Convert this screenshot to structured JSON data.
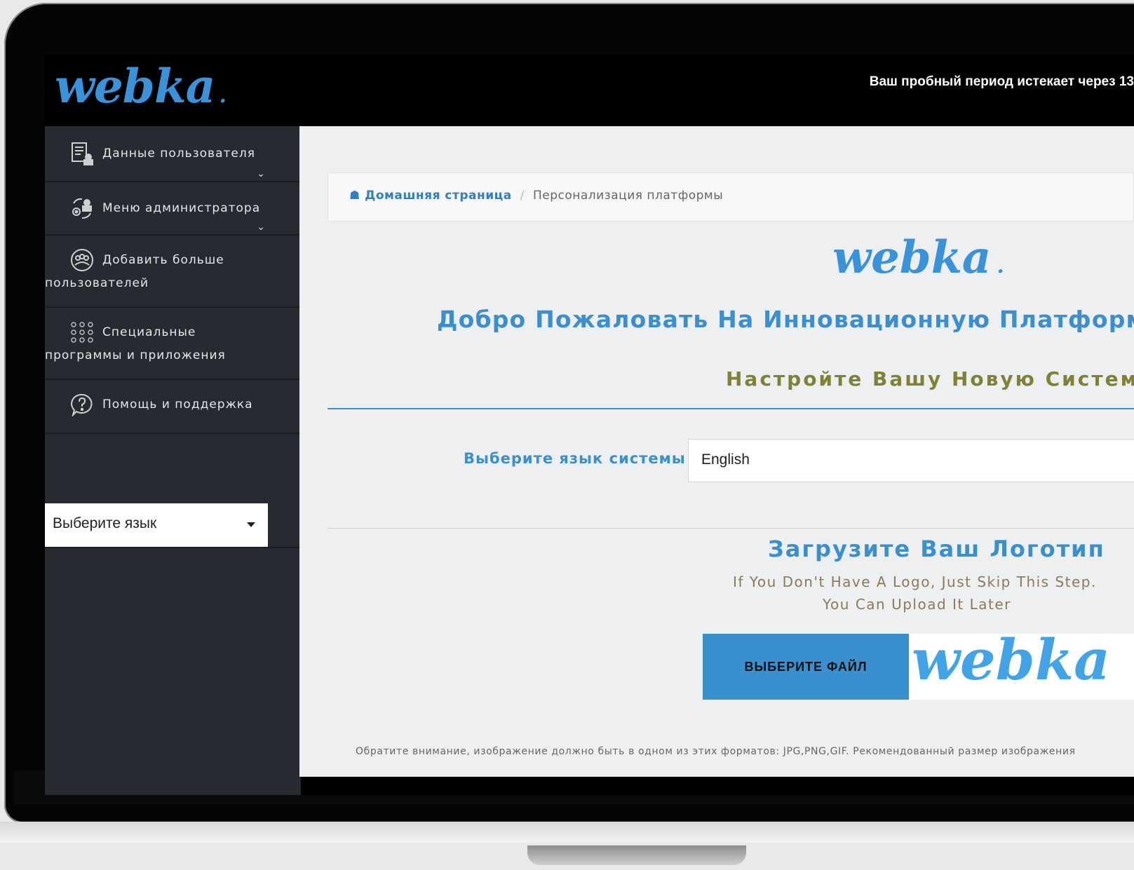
{
  "header": {
    "logo_text": "webka",
    "logo_dot": ".",
    "trial_text": "Ваш пробный период истекает через 13"
  },
  "sidebar": {
    "items": [
      {
        "label": "Данные пользователя",
        "icon": "user-data-icon"
      },
      {
        "label": "Меню администратора",
        "icon": "admin-menu-icon"
      },
      {
        "label": "Добавить больше пользователей",
        "label_line1": "Добавить больше",
        "label_line2": "пользователей",
        "icon": "add-users-icon"
      },
      {
        "label_line1": "Специальные",
        "label_line2": "программы и приложения",
        "icon": "apps-grid-icon"
      },
      {
        "label": "Помощь и поддержка",
        "icon": "help-icon"
      }
    ],
    "language_select": "Выберите язык"
  },
  "breadcrumb": {
    "home": "Домашняя страница",
    "separator": "/",
    "current": "Персонализация платформы"
  },
  "main": {
    "logo_text": "webka",
    "logo_dot": ".",
    "welcome": "Добро Пожаловать На Инновационную Платформу",
    "setup": "Настройте Вашу Новую Систем",
    "language_label": "Выберите язык системы",
    "language_value": "English",
    "upload_title": "Загрузите Ваш Логотип",
    "upload_hint_1": "If You Don't Have A Logo, Just Skip This Step.",
    "upload_hint_2": "You Can Upload It Later",
    "file_button": "ВЫБЕРИТЕ ФАЙЛ",
    "preview_logo": "webka",
    "note": "Обратите внимание, изображение должно быть в одном из этих форматов: JPG,PNG,GIF. Рекомендованный размер изображения"
  },
  "colors": {
    "accent": "#3a8fcf",
    "sidebar_bg": "#262b31",
    "setup_text": "#7e8136"
  }
}
